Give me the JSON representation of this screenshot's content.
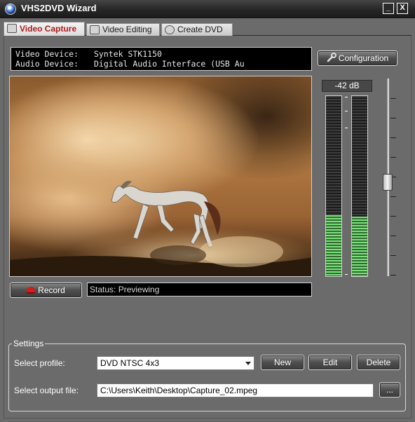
{
  "window": {
    "title": "VHS2DVD Wizard",
    "minimize_label": "_",
    "close_label": "X"
  },
  "tabs": [
    {
      "label": "Video Capture",
      "active": true
    },
    {
      "label": "Video Editing",
      "active": false
    },
    {
      "label": "Create DVD",
      "active": false
    }
  ],
  "devices": {
    "video_label": "Video Device:",
    "video_value": "Syntek STK1150",
    "audio_label": "Audio Device:",
    "audio_value": "Digital Audio Interface (USB Au"
  },
  "buttons": {
    "configuration": "Configuration",
    "record": "Record",
    "new": "New",
    "edit": "Edit",
    "delete": "Delete",
    "browse": "..."
  },
  "preview": {
    "scene": "horse-running-in-dust"
  },
  "audio": {
    "level_label": "-42 dB",
    "left_level_fraction": 0.34,
    "right_level_fraction": 0.33,
    "volume_fraction": 0.5,
    "level_color": "#7ee07e"
  },
  "status": {
    "text": "Status: Previewing"
  },
  "settings": {
    "legend": "Settings",
    "profile_label": "Select profile:",
    "profile_value": "DVD NTSC 4x3",
    "output_label": "Select output file:",
    "output_value": "C:\\Users\\Keith\\Desktop\\Capture_02.mpeg"
  },
  "icons": {
    "app": "disc-icon",
    "config": "wrench-icon",
    "record": "record-icon",
    "dropdown": "chevron-down-icon"
  },
  "colors": {
    "background": "#6b6b6b",
    "active_tab_text": "#b01c1c",
    "record_red": "#d11d1d"
  }
}
